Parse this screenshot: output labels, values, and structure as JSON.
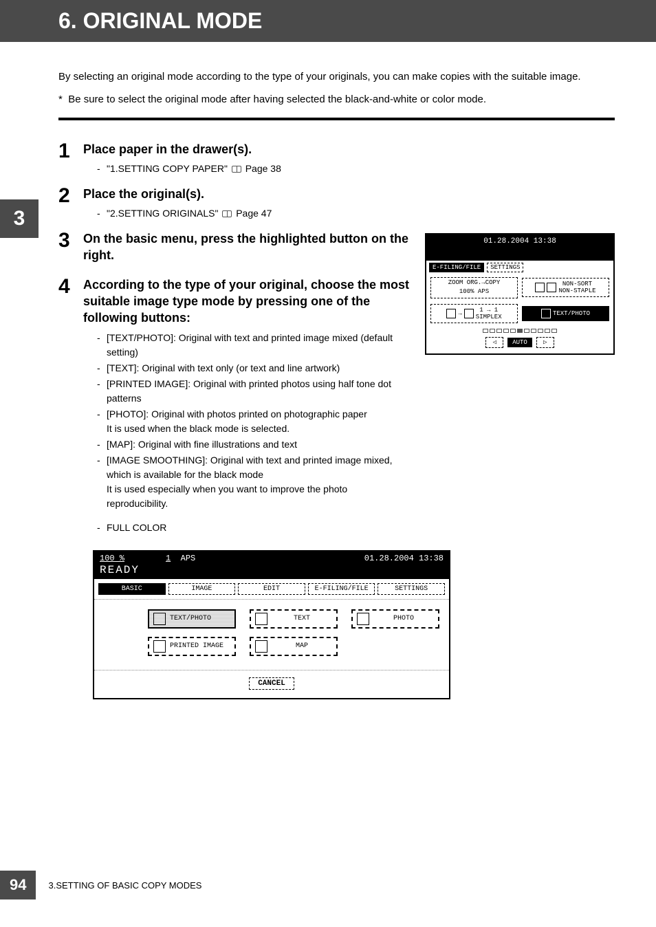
{
  "title": "6. ORIGINAL MODE",
  "section_tab": "3",
  "intro": "By selecting an original mode according to the type of your originals, you can make copies with the suitable image.",
  "note_prefix": "*",
  "note": "Be sure to select the original mode after having selected the black-and-white or color mode.",
  "steps": {
    "s1": {
      "num": "1",
      "title": "Place paper in the drawer(s).",
      "ref": "\"1.SETTING COPY PAPER\"",
      "ref_page": "Page 38"
    },
    "s2": {
      "num": "2",
      "title": "Place the original(s).",
      "ref": "\"2.SETTING ORIGINALS\"",
      "ref_page": "Page 47"
    },
    "s3": {
      "num": "3",
      "title": "On the basic menu, press the highlighted button on the right."
    },
    "s4": {
      "num": "4",
      "title": "According to the type of your original, choose the most suitable image type mode by pressing one of the following buttons:",
      "items": {
        "a": "[TEXT/PHOTO]: Original with text and printed image mixed (default setting)",
        "b": "[TEXT]: Original with text only (or text and line artwork)",
        "c": "[PRINTED IMAGE]: Original with printed photos using half tone dot patterns",
        "d": "[PHOTO]: Original with photos printed on photographic paper\nIt is used when the black mode is selected.",
        "e": " [MAP]: Original with fine illustrations and text",
        "f": "[IMAGE SMOOTHING]: Original with text and printed image mixed, which is available for the black mode\nIt is used especially when you want to improve the photo reproducibility."
      },
      "extra": "FULL COLOR"
    }
  },
  "small_panel": {
    "timestamp": "01.28.2004 13:38",
    "tabs": {
      "a": "E-FILING/FILE",
      "b": "SETTINGS"
    },
    "row1": {
      "left": "ZOOM  ORG.→COPY",
      "left2": "100%      APS",
      "right": "NON-SORT\nNON-STAPLE"
    },
    "row2": {
      "left": "1 → 1\nSIMPLEX",
      "right": "TEXT/PHOTO"
    },
    "nav": {
      "left": "◁",
      "mid": "AUTO",
      "right": "▷"
    }
  },
  "large_panel": {
    "hdr": {
      "pct": "100  %",
      "count": "1",
      "aps": "APS",
      "ts": "01.28.2004 13:38"
    },
    "ready": "READY",
    "tabs": {
      "a": "BASIC",
      "b": "IMAGE",
      "c": "EDIT",
      "d": "E-FILING/FILE",
      "e": "SETTINGS"
    },
    "btns": {
      "a": "TEXT/PHOTO",
      "b": "TEXT",
      "c": "PHOTO",
      "d": "PRINTED IMAGE",
      "e": "MAP"
    },
    "cancel": "CANCEL"
  },
  "footer": {
    "page": "94",
    "chapter": "3.SETTING OF BASIC COPY MODES"
  }
}
